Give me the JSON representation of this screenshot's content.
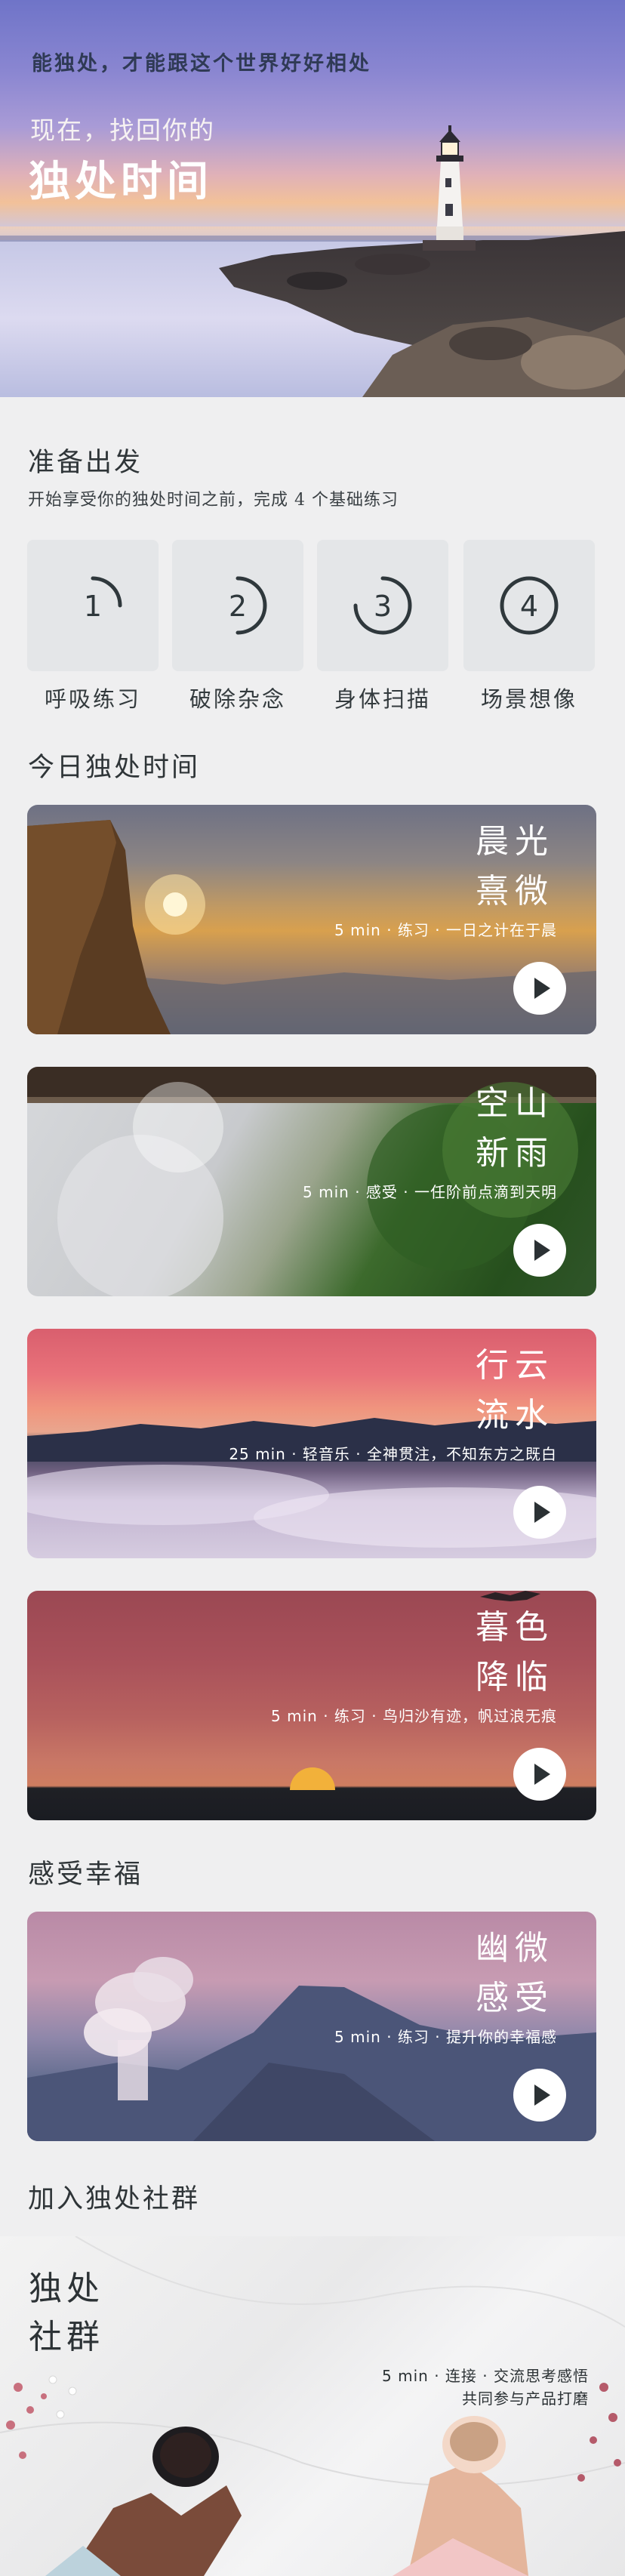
{
  "hero": {
    "quote": "能独处，才能跟这个世界好好相处",
    "subtitle": "现在，找回你的",
    "title": "独处时间"
  },
  "prepare": {
    "title": "准备出发",
    "description": "开始享受你的独处时间之前，完成 4 个基础练习",
    "steps": [
      {
        "number": "1",
        "label": "呼吸练习"
      },
      {
        "number": "2",
        "label": "破除杂念"
      },
      {
        "number": "3",
        "label": "身体扫描"
      },
      {
        "number": "4",
        "label": "场景想像"
      }
    ]
  },
  "today": {
    "title": "今日独处时间",
    "cards": [
      {
        "line1": "晨光",
        "line2": "熹微",
        "meta": "5 min  ·  练习  ·  一日之计在于晨"
      },
      {
        "line1": "空山",
        "line2": "新雨",
        "meta": "5 min  ·  感受  ·  一任阶前点滴到天明"
      },
      {
        "line1": "行云",
        "line2": "流水",
        "meta": "25 min  ·  轻音乐  ·  全神贯注，不知东方之既白"
      },
      {
        "line1": "暮色",
        "line2": "降临",
        "meta": "5 min · 练习  ·  鸟归沙有迹，帆过浪无痕"
      }
    ]
  },
  "happiness": {
    "title": "感受幸福",
    "card": {
      "line1": "幽微",
      "line2": "感受",
      "meta": "5 min  ·  练习  ·  提升你的幸福感"
    }
  },
  "community": {
    "title": "加入独处社群",
    "line1": "独处",
    "line2": "社群",
    "meta_line1": "5 min  ·  连接  ·  交流思考感悟",
    "meta_line2": "共同参与产品打磨"
  },
  "icons": {
    "play": "play-icon"
  }
}
